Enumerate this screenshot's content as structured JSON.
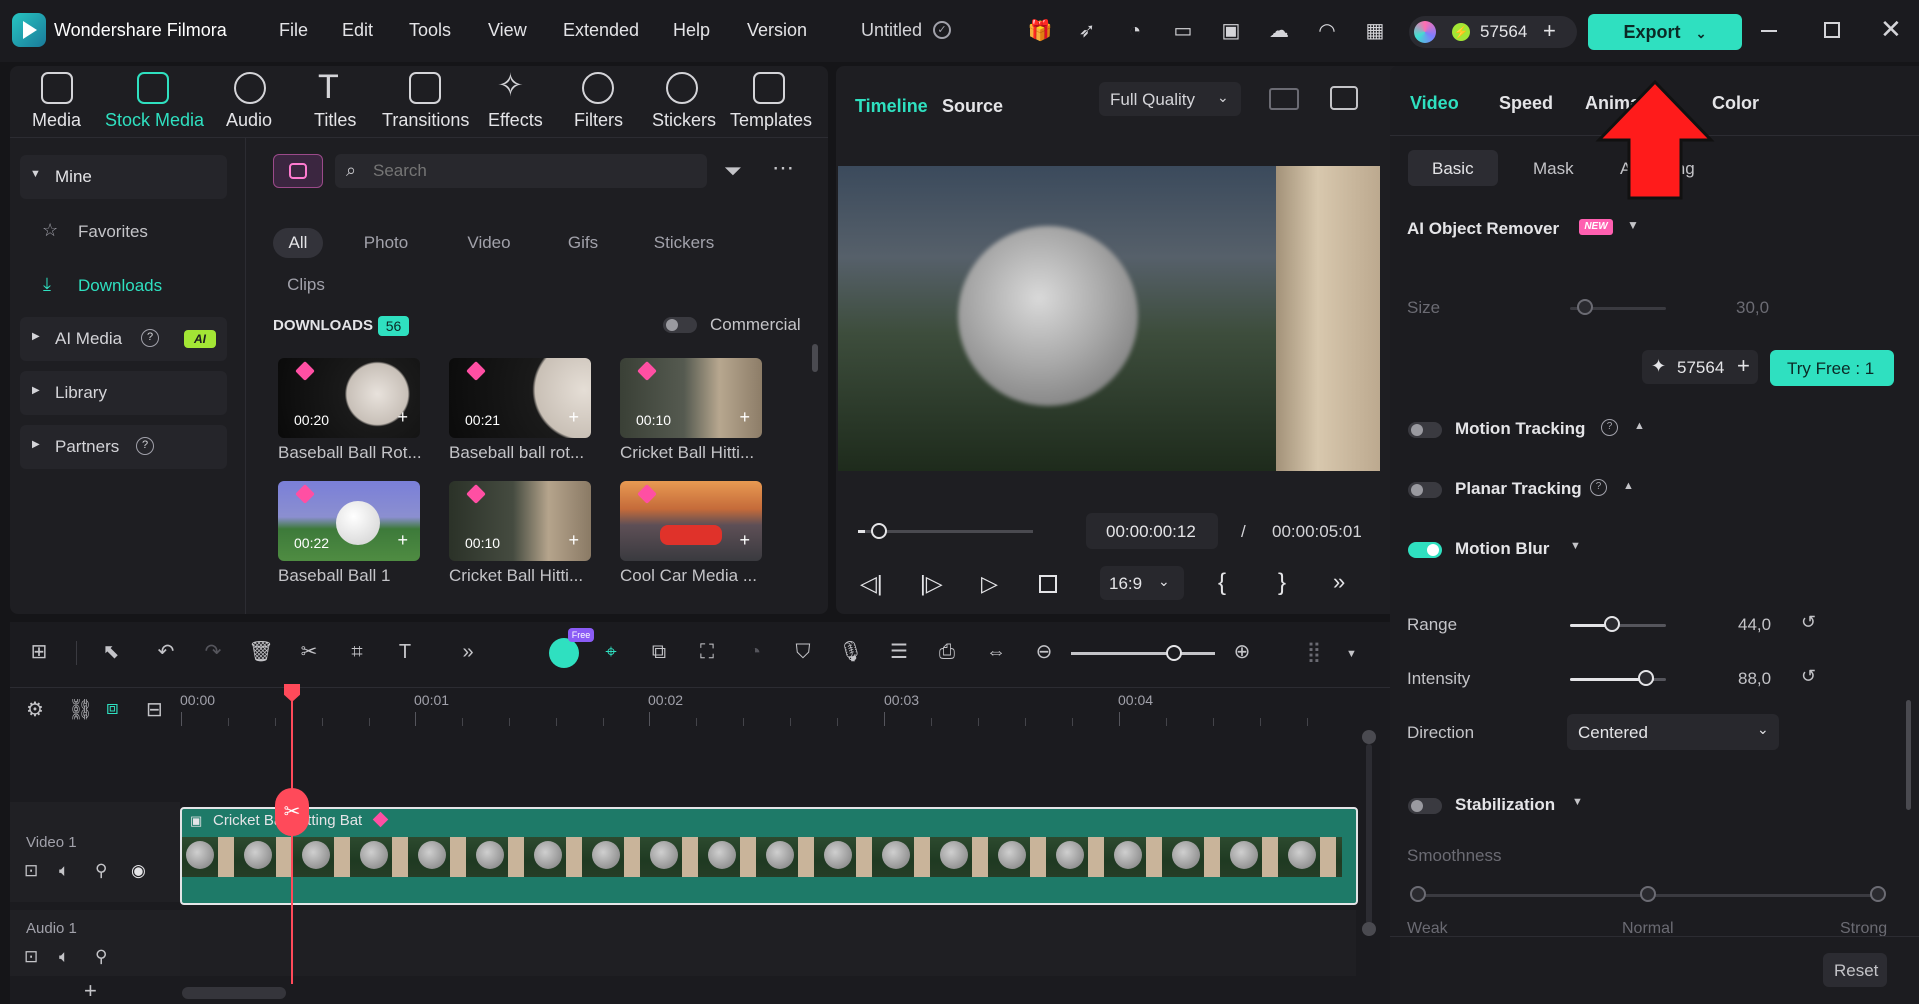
{
  "app": {
    "name": "Wondershare Filmora",
    "project_title": "Untitled",
    "credits": "57564"
  },
  "menu": [
    "File",
    "Edit",
    "Tools",
    "View",
    "Extended",
    "Help",
    "Version"
  ],
  "toolbar_export": "Export",
  "media_tabs": [
    {
      "label": "Media",
      "icon": "media-icon"
    },
    {
      "label": "Stock Media",
      "icon": "stock-media-icon"
    },
    {
      "label": "Audio",
      "icon": "audio-icon"
    },
    {
      "label": "Titles",
      "icon": "titles-icon"
    },
    {
      "label": "Transitions",
      "icon": "transitions-icon"
    },
    {
      "label": "Effects",
      "icon": "effects-icon"
    },
    {
      "label": "Filters",
      "icon": "filters-icon"
    },
    {
      "label": "Stickers",
      "icon": "stickers-icon"
    },
    {
      "label": "Templates",
      "icon": "templates-icon"
    }
  ],
  "sidebar": {
    "mine": "Mine",
    "favorites": "Favorites",
    "downloads": "Downloads",
    "ai_media": "AI Media",
    "ai_badge": "AI",
    "library": "Library",
    "partners": "Partners"
  },
  "search": {
    "placeholder": "Search"
  },
  "filters": [
    "All",
    "Photo",
    "Video",
    "Gifs",
    "Stickers",
    "Clips"
  ],
  "downloads": {
    "label": "DOWNLOADS",
    "count": "56",
    "commercial": "Commercial"
  },
  "assets": [
    {
      "title": "Baseball Ball Rot...",
      "duration": "00:20"
    },
    {
      "title": "Baseball ball rot...",
      "duration": "00:21"
    },
    {
      "title": "Cricket Ball Hitti...",
      "duration": "00:10"
    },
    {
      "title": "Baseball Ball 1",
      "duration": "00:22"
    },
    {
      "title": "Cricket Ball Hitti...",
      "duration": "00:10"
    },
    {
      "title": "Cool Car Media ...",
      "duration": ""
    }
  ],
  "preview": {
    "tab_timeline": "Timeline",
    "tab_source": "Source",
    "quality": "Full Quality",
    "current_time": "00:00:00:12",
    "separator": "/",
    "total_time": "00:00:05:01",
    "aspect": "16:9",
    "progress": 0.04
  },
  "right_panel": {
    "tabs": [
      "Video",
      "Speed",
      "Animation",
      "Color"
    ],
    "subtabs": [
      "Basic",
      "Mask",
      "AI Cutting"
    ],
    "ai_object_remover": "AI Object Remover",
    "new_badge": "NEW",
    "size_label": "Size",
    "size_value": "30,0",
    "credits": "57564",
    "try_free": "Try Free : 1",
    "motion_tracking": "Motion Tracking",
    "planar_tracking": "Planar Tracking",
    "motion_blur": "Motion Blur",
    "range_label": "Range",
    "range_value": "44,0",
    "intensity_label": "Intensity",
    "intensity_value": "88,0",
    "direction_label": "Direction",
    "direction_value": "Centered",
    "stabilization": "Stabilization",
    "smoothness": "Smoothness",
    "smooth_weak": "Weak",
    "smooth_normal": "Normal",
    "smooth_strong": "Strong",
    "reset": "Reset"
  },
  "timeline": {
    "ruler": [
      "00:00",
      "00:01",
      "00:02",
      "00:03",
      "00:04"
    ],
    "video_track": "Video 1",
    "audio_track": "Audio 1",
    "clip_title": "Cricket Ball Hitting Bat",
    "free_badge": "Free"
  },
  "colors": {
    "accent": "#2fe0c0",
    "playhead": "#ff4a5a",
    "annotation_arrow": "#ff1b1b"
  }
}
